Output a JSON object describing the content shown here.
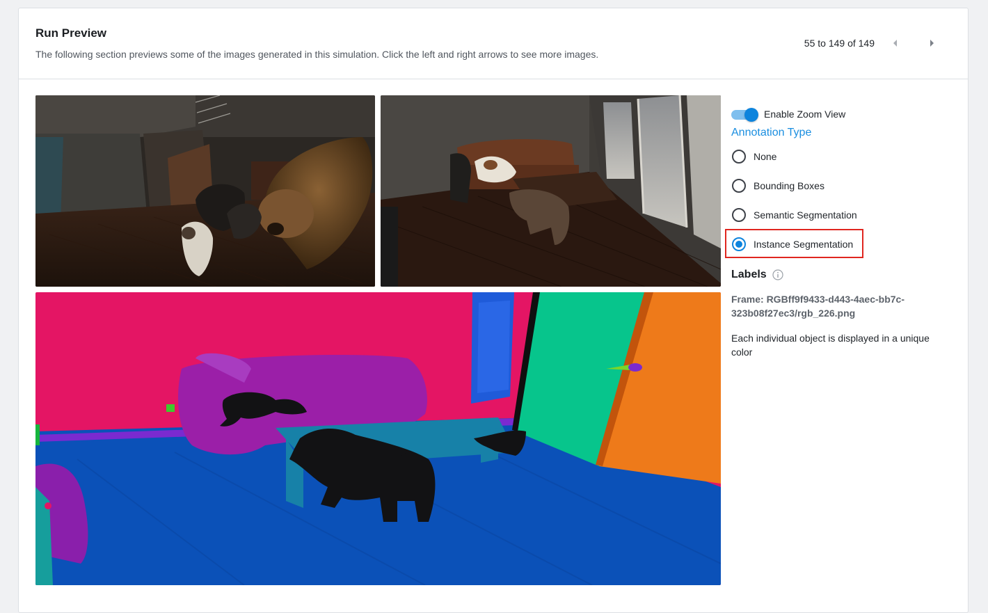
{
  "header": {
    "title": "Run Preview",
    "subtitle": "The following section previews some of the images generated in this simulation. Click the left and right arrows to see more images.",
    "pager_text": "55 to 149 of 149"
  },
  "icons": {
    "prev": "caret-left-icon",
    "next": "caret-right-icon",
    "info": "info-circle-icon"
  },
  "controls": {
    "zoom_label": "Enable Zoom View",
    "zoom_enabled": true,
    "annotation_title": "Annotation Type",
    "options": [
      {
        "label": "None",
        "selected": false
      },
      {
        "label": "Bounding Boxes",
        "selected": false
      },
      {
        "label": "Semantic Segmentation",
        "selected": false
      },
      {
        "label": "Instance Segmentation",
        "selected": true
      }
    ]
  },
  "labels": {
    "title": "Labels",
    "frame": "Frame: RGBff9f9433-d443-4aec-bb7c-323b08f27ec3/rgb_226.png",
    "description": "Each individual object is displayed in a unique color"
  },
  "colors": {
    "accent": "#0d84dd",
    "link": "#1a8ee0",
    "highlight": "#e0261f"
  }
}
